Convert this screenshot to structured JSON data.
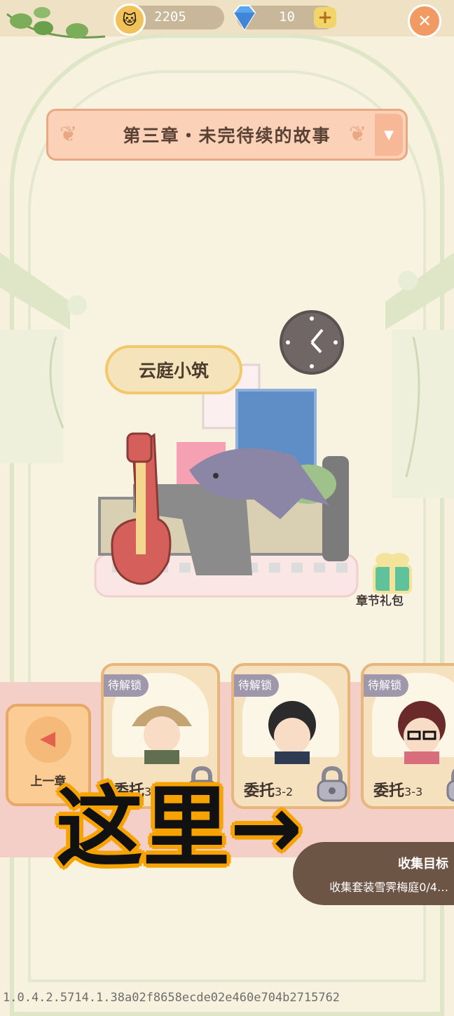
{
  "topbar": {
    "coins": "2205",
    "gems": "10",
    "add_symbol": "+",
    "close_symbol": "✕"
  },
  "chapter": {
    "title": "第三章・未完待续的故事",
    "dropdown_symbol": "▼"
  },
  "room": {
    "name": "云庭小筑"
  },
  "gift": {
    "label": "章节礼包"
  },
  "previous_chapter": {
    "label": "上一章"
  },
  "commissions": [
    {
      "status": "待解锁",
      "name": "委托",
      "number": "3-1"
    },
    {
      "status": "待解锁",
      "name": "委托",
      "number": "3-2"
    },
    {
      "status": "待解锁",
      "name": "委托",
      "number": "3-3"
    }
  ],
  "goal": {
    "title": "收集目标",
    "description": "收集套装雪霁梅庭0/4…"
  },
  "overlay": {
    "text": "这里→"
  },
  "version": "1.0.4.2.5714.1.38a02f8658ecde02e460e704b2715762"
}
